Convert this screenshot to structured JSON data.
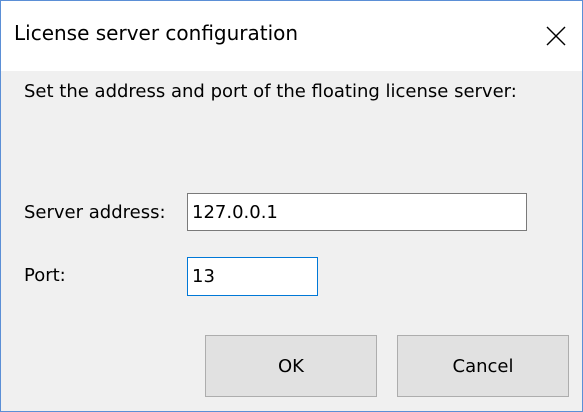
{
  "window": {
    "title": "License server configuration"
  },
  "dialog": {
    "description": "Set the address and port of the floating license server:",
    "server_address_label": "Server address:",
    "server_address_value": "127.0.0.1",
    "port_label": "Port:",
    "port_value": "13",
    "ok_label": "OK",
    "cancel_label": "Cancel"
  },
  "icons": {
    "close": "close-icon"
  },
  "colors": {
    "window_border": "#5b8fd6",
    "focus_border": "#0078d7",
    "dialog_background": "#f0f0f0",
    "button_background": "#e1e1e1"
  }
}
